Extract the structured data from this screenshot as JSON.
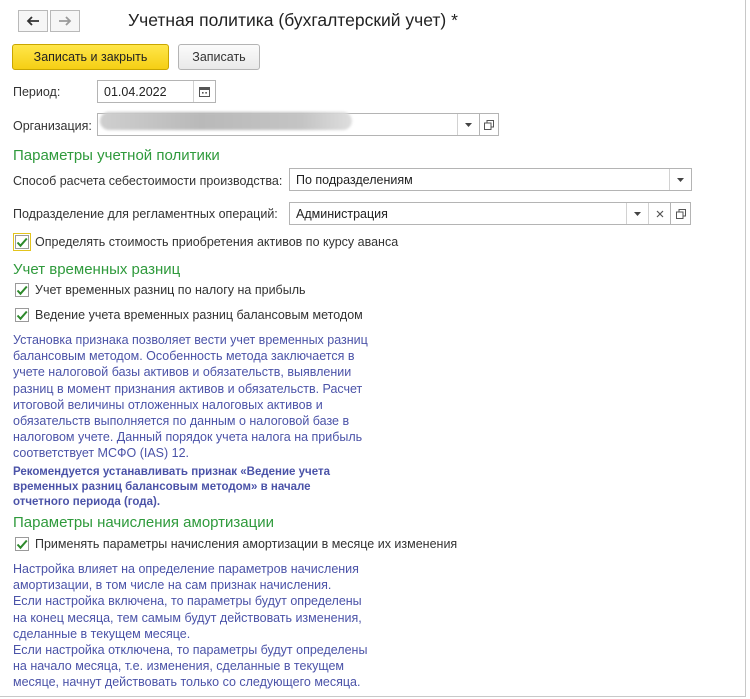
{
  "window": {
    "title": "Учетная политика (бухгалтерский учет) *"
  },
  "nav": {
    "back_icon": "arrow-left-icon",
    "forward_icon": "arrow-right-icon"
  },
  "toolbar": {
    "save_close_label": "Записать и закрыть",
    "save_label": "Записать"
  },
  "period": {
    "label": "Период:",
    "value": "01.04.2022",
    "icon": "calendar-icon"
  },
  "organization": {
    "label": "Организация:",
    "value": ""
  },
  "policy_section": {
    "title": "Параметры учетной политики",
    "cost_method_label": "Способ расчета себестоимости производства:",
    "cost_method_value": "По подразделениям",
    "division_label": "Подразделение для регламентных операций:",
    "division_value": "Администрация",
    "advance_rate_label": "Определять стоимость приобретения активов по курсу аванса",
    "advance_rate_checked": true
  },
  "temp_diff_section": {
    "title": "Учет временных разниц",
    "profit_tax_label": "Учет временных разниц по налогу на прибыль",
    "profit_tax_checked": true,
    "balance_method_label": "Ведение учета временных разниц балансовым методом",
    "balance_method_checked": true,
    "note_lines": [
      "Установка признака позволяет вести учет временных разниц",
      "балансовым методом.  Особенность метода заключается в",
      "учете налоговой базы активов и обязательств, выявлении",
      "разниц  в момент признания активов и обязательств. Расчет",
      "итоговой величины отложенных налоговых активов и",
      "обязательств выполняется по данным о налоговой базе в",
      "налоговом учете. Данный порядок учета налога на прибыль",
      "соответствует МСФО (IAS)  12."
    ],
    "recommend_lines": [
      "Рекомендуется устанавливать признак «Ведение учета",
      "временных разниц балансовым методом» в начале",
      "отчетного периода (года)."
    ]
  },
  "amort_section": {
    "title": "Параметры начисления амортизации",
    "apply_label": "Применять параметры начисления амортизации в месяце их изменения",
    "apply_checked": true,
    "note_lines": [
      "Настройка влияет на определение параметров начисления",
      "амортизации, в том числе на сам признак начисления.",
      "Если настройка включена, то параметры будут определены",
      "на конец месяца, тем самым будут действовать изменения,",
      "сделанные в текущем месяце.",
      "Если настройка отключена, то параметры будут определены",
      "на начало месяца, т.е. изменения, сделанные в текущем",
      "месяце, начнут действовать только со следующего месяца."
    ]
  },
  "colors": {
    "section_green": "#2f9a3c",
    "note_blue": "#4b53a8",
    "primary_yellow": "#f5cf14"
  }
}
